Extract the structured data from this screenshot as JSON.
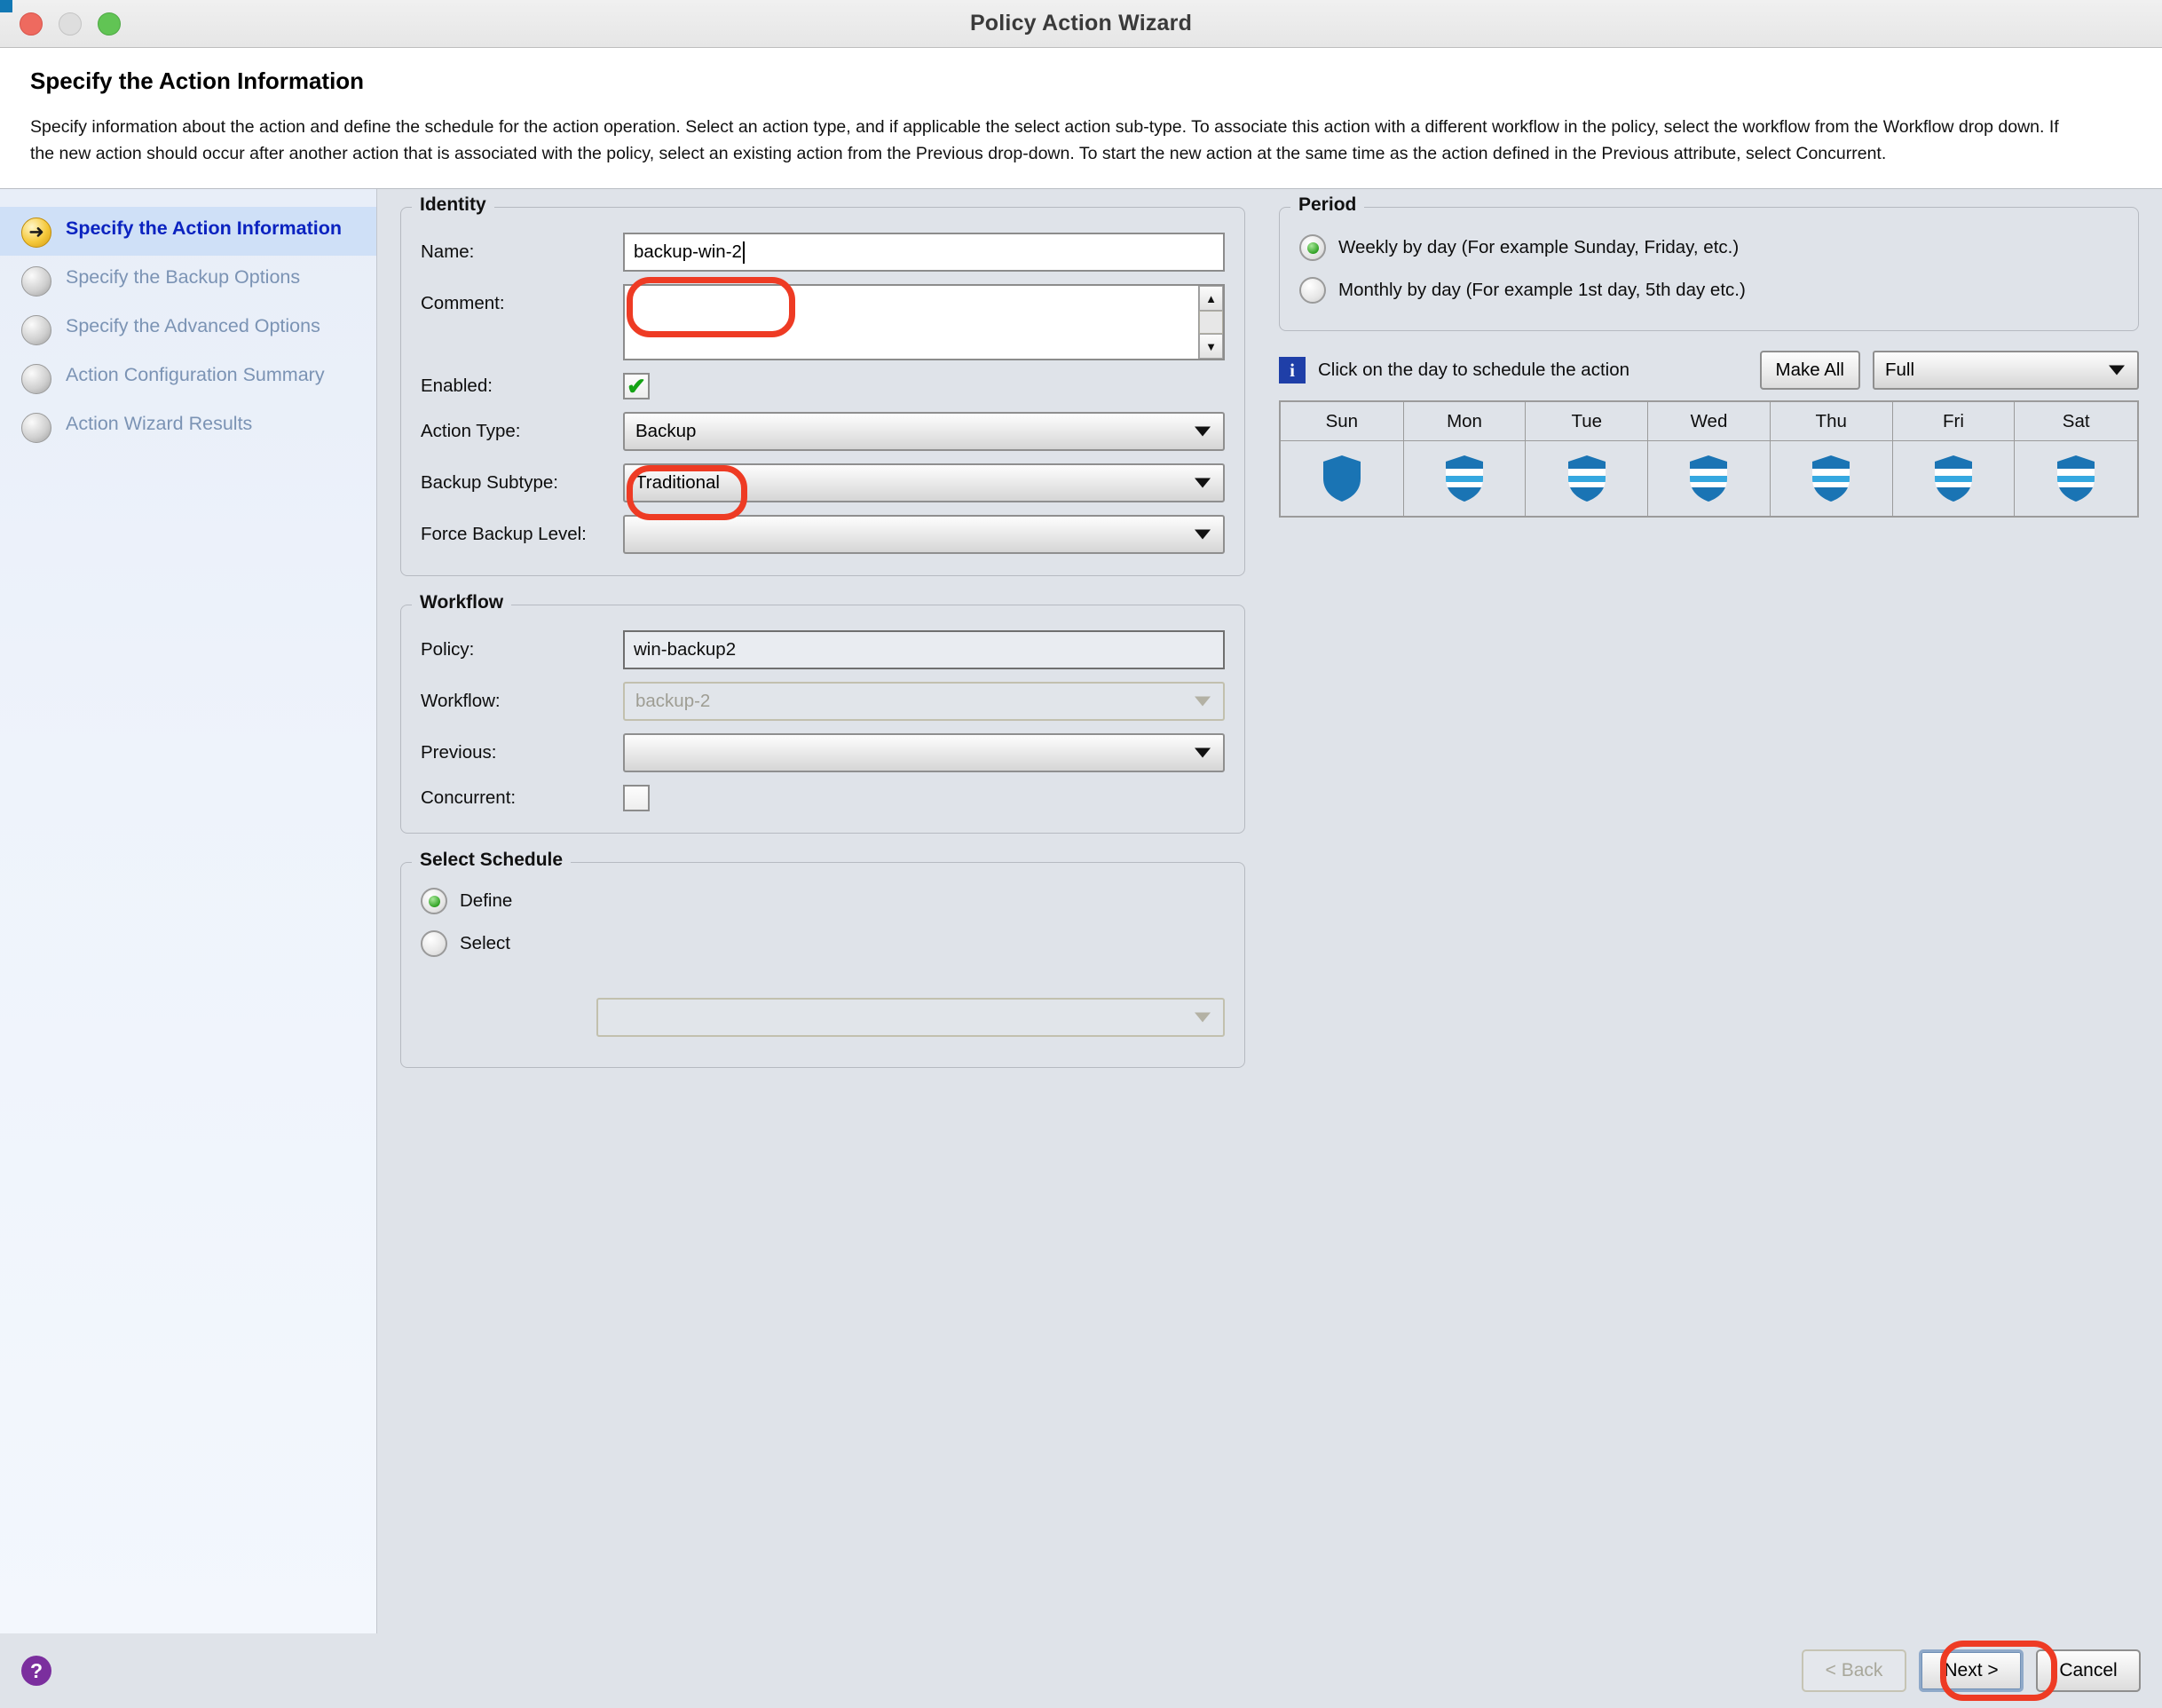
{
  "window": {
    "title": "Policy Action Wizard",
    "controls": [
      "close-button",
      "minimize-button",
      "zoom-button"
    ]
  },
  "header": {
    "title": "Specify the Action Information",
    "description": "Specify information about the action and define the schedule for the action operation. Select an action type, and if applicable the select action sub-type. To associate this action with a different workflow in the policy, select the workflow from the Workflow drop down. If the new action should occur after another action that is associated with the policy, select an existing action from the Previous drop-down. To start the new action at the same time as the action defined in the Previous attribute, select Concurrent."
  },
  "sidebar": {
    "items": [
      {
        "label": "Specify the Action Information",
        "state": "current"
      },
      {
        "label": "Specify the Backup Options",
        "state": "pending"
      },
      {
        "label": "Specify the Advanced Options",
        "state": "pending"
      },
      {
        "label": "Action Configuration Summary",
        "state": "pending"
      },
      {
        "label": "Action Wizard Results",
        "state": "pending"
      }
    ]
  },
  "identity": {
    "legend": "Identity",
    "name_label": "Name:",
    "name_value": "backup-win-2",
    "comment_label": "Comment:",
    "comment_value": "",
    "enabled_label": "Enabled:",
    "enabled_checked": true,
    "enabled_tick": "✔",
    "action_type_label": "Action Type:",
    "action_type_value": "Backup",
    "backup_subtype_label": "Backup Subtype:",
    "backup_subtype_value": "Traditional",
    "force_backup_level_label": "Force Backup Level:",
    "force_backup_level_value": ""
  },
  "workflow": {
    "legend": "Workflow",
    "policy_label": "Policy:",
    "policy_value": "win-backup2",
    "workflow_label": "Workflow:",
    "workflow_value": "backup-2",
    "previous_label": "Previous:",
    "previous_value": "",
    "concurrent_label": "Concurrent:",
    "concurrent_checked": false
  },
  "select_schedule": {
    "legend": "Select Schedule",
    "options": [
      {
        "label": "Define",
        "selected": true
      },
      {
        "label": "Select",
        "selected": false
      }
    ],
    "schedule_combo_value": ""
  },
  "period": {
    "legend": "Period",
    "options": [
      {
        "label": "Weekly by day  (For example Sunday, Friday, etc.)",
        "selected": true
      },
      {
        "label": "Monthly by day (For example 1st day, 5th day etc.)",
        "selected": false
      }
    ]
  },
  "schedule": {
    "info_glyph": "i",
    "hint": "Click on the day to schedule the action",
    "make_all_label": "Make All",
    "level_value": "Full",
    "day_headers": [
      "Sun",
      "Mon",
      "Tue",
      "Wed",
      "Thu",
      "Fri",
      "Sat"
    ],
    "day_levels": [
      "full",
      "incremental",
      "incremental",
      "incremental",
      "incremental",
      "incremental",
      "incremental"
    ]
  },
  "footer": {
    "help_glyph": "?",
    "back_label": "< Back",
    "back_disabled": true,
    "next_label": "Next >",
    "cancel_label": "Cancel"
  },
  "annotations": {
    "accent_color": "#ee3b24",
    "targets": [
      "name-field",
      "action-type-combo",
      "next-button"
    ]
  },
  "colors": {
    "accent_red": "#ee3b24",
    "shield_full": "#1a74b4",
    "shield_stripe": "#35a8e0",
    "info_blue": "#1f3fa8",
    "help_purple": "#7b2f9e",
    "active_nav_text": "#0b23c0",
    "nav_text": "#7b93b4"
  }
}
